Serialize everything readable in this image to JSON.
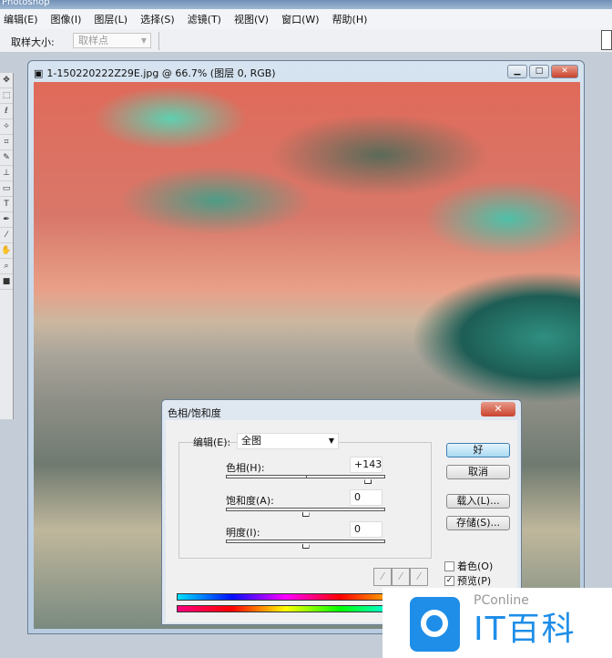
{
  "app": {
    "title": "Photoshop"
  },
  "menu": [
    "编辑(E)",
    "图像(I)",
    "图层(L)",
    "选择(S)",
    "滤镜(T)",
    "视图(V)",
    "窗口(W)",
    "帮助(H)"
  ],
  "options": {
    "sample_size_label": "取样大小:",
    "sample_size_value": "取样点"
  },
  "document": {
    "title": "1-150220222Z29E.jpg @ 66.7% (图层 0, RGB)"
  },
  "dialog": {
    "title": "色相/饱和度",
    "edit_label": "编辑(E):",
    "edit_value": "全图",
    "hue_label": "色相(H):",
    "hue_value": "+143",
    "hue_fraction": 0.897,
    "saturation_label": "饱和度(A):",
    "saturation_value": "0",
    "saturation_fraction": 0.5,
    "lightness_label": "明度(I):",
    "lightness_value": "0",
    "lightness_fraction": 0.5,
    "ok": "好",
    "cancel": "取消",
    "load": "载入(L)...",
    "save": "存储(S)...",
    "colorize_label": "着色(O)",
    "colorize_checked": false,
    "preview_label": "预览(P)",
    "preview_checked": true
  },
  "watermark": {
    "brand": "PConline",
    "name": "IT百科"
  }
}
